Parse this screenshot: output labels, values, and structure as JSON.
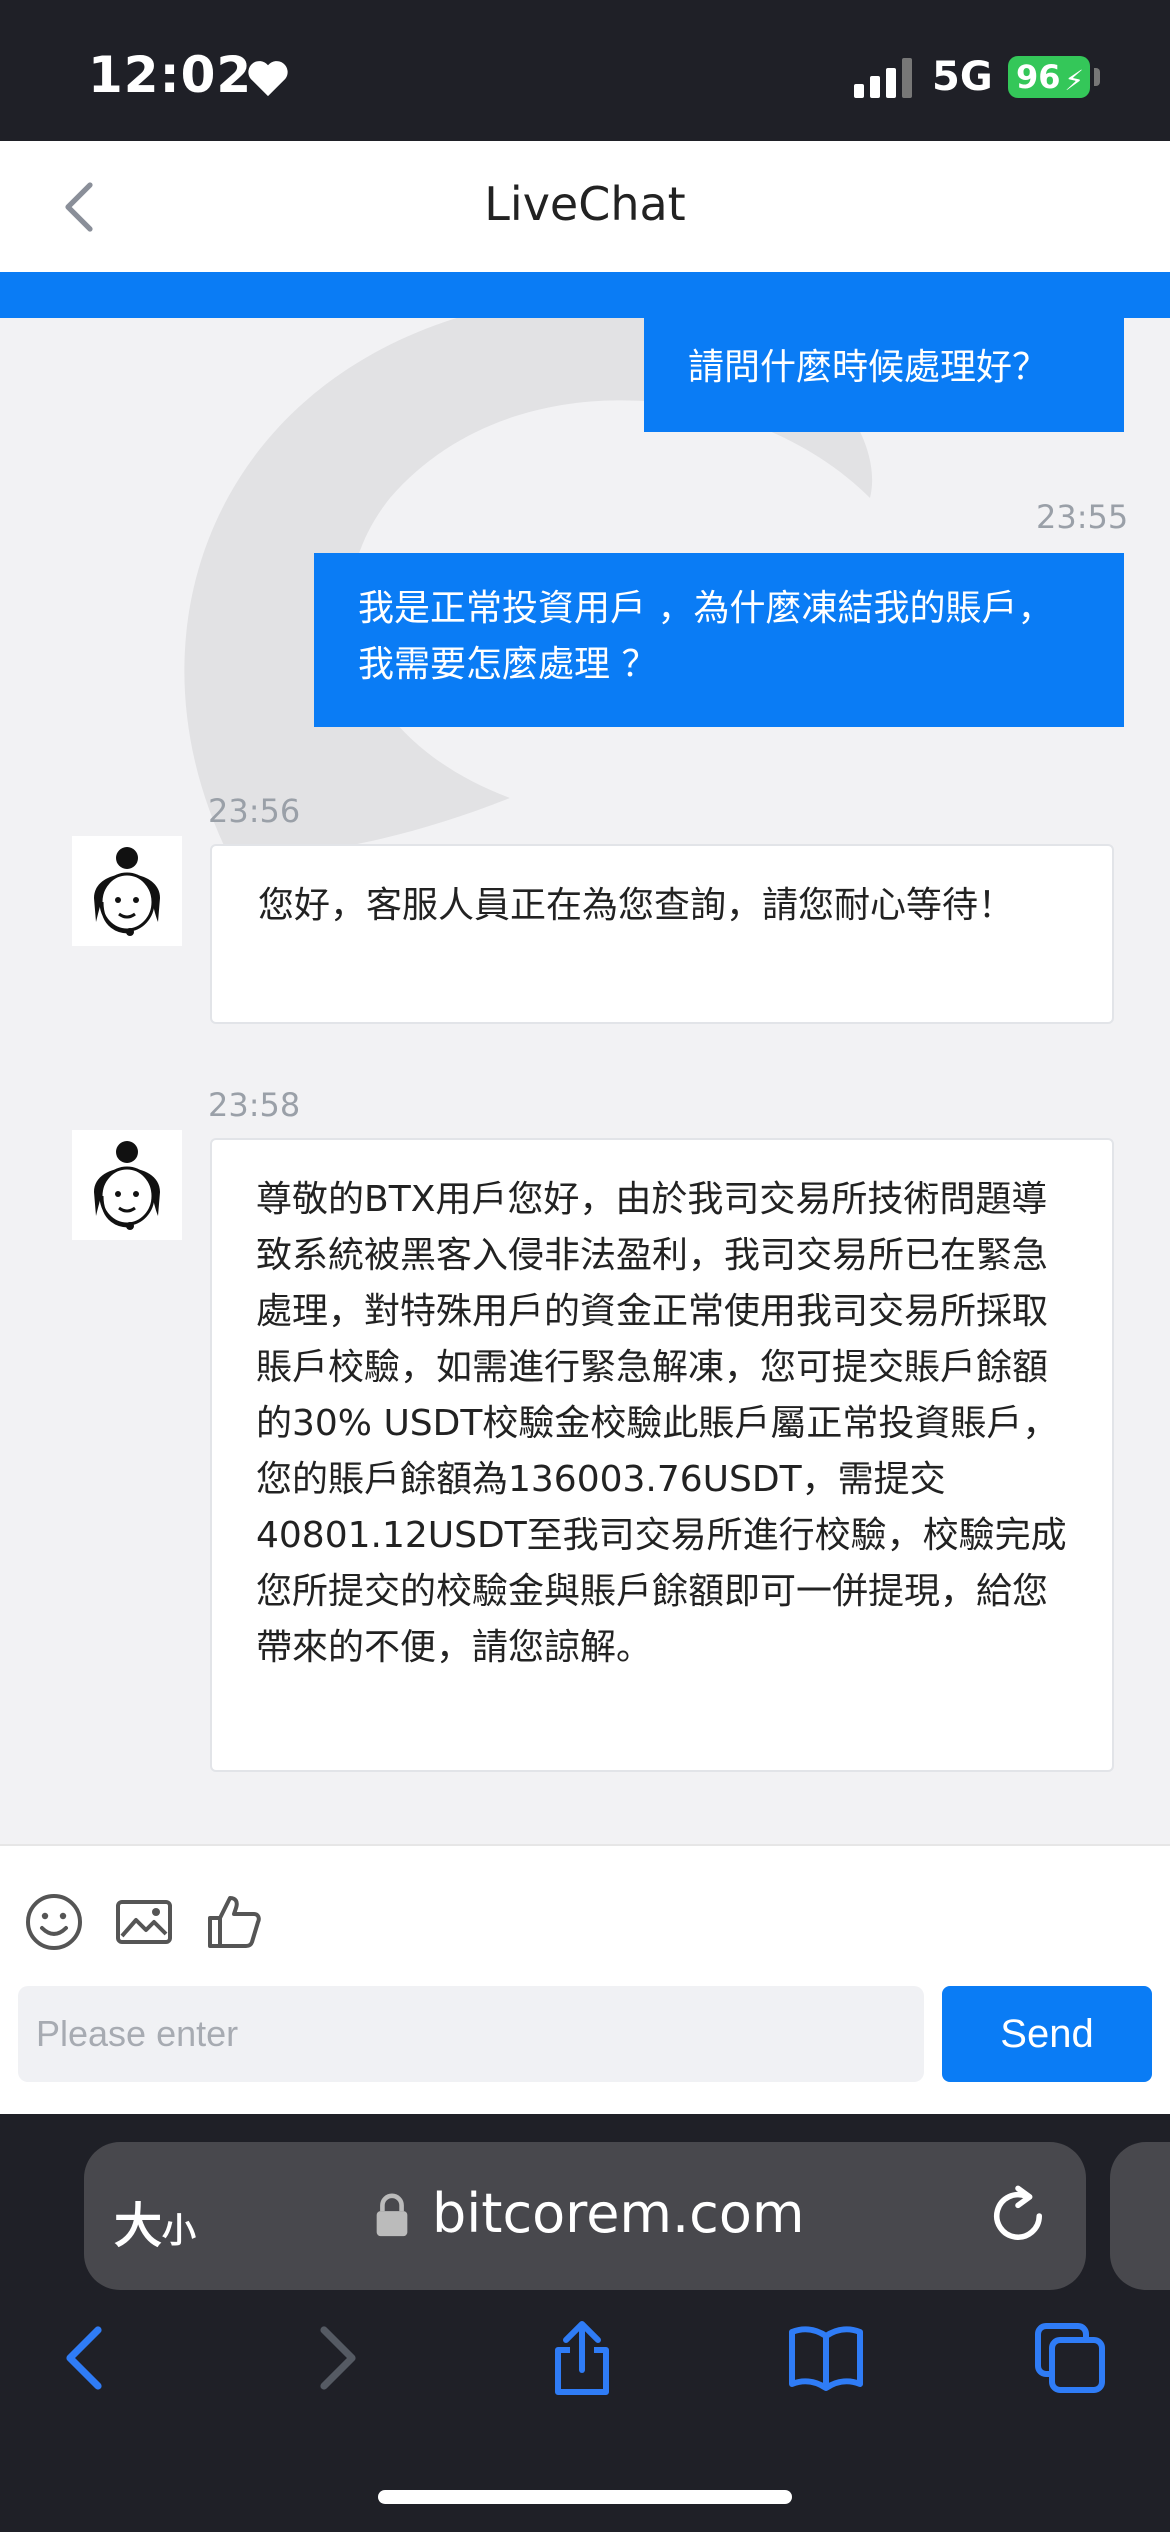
{
  "status_bar": {
    "time": "12:02",
    "network": "5G",
    "battery": "96"
  },
  "header": {
    "title": "LiveChat"
  },
  "messages": [
    {
      "type": "outgoing",
      "text": "請問什麼時候處理好？"
    },
    {
      "type": "outgoing",
      "time": "23:55",
      "text": "我是正常投資用戶 ，為什麼凍結我的賬戶，我需要怎麼處理 ？"
    },
    {
      "type": "incoming",
      "time": "23:56",
      "text": "您好，客服人員正在為您查詢，請您耐心等待！"
    },
    {
      "type": "incoming",
      "time": "23:58",
      "text": "尊敬的BTX用戶您好，由於我司交易所技術問題導致系統被黑客入侵非法盈利，我司交易所已在緊急處理，對特殊用戶的資金正常使用我司交易所採取賬戶校驗，如需進行緊急解凍，您可提交賬戶餘額的30% USDT校驗金校驗此賬戶屬正常投資賬戶，您的賬戶餘額為136003.76USDT，需提交40801.12USDT至我司交易所進行校驗，校驗完成您所提交的校驗金與賬戶餘額即可一併提現，給您帶來的不便，請您諒解。"
    }
  ],
  "input": {
    "placeholder": "Please enter",
    "value": "",
    "send_label": "Send"
  },
  "browser": {
    "text_size_label_big": "大",
    "text_size_label_small": "小",
    "url": "bitcorem.com"
  },
  "colors": {
    "accent": "#0a7cf5",
    "status_bar": "#1f2027",
    "battery": "#34c759"
  }
}
